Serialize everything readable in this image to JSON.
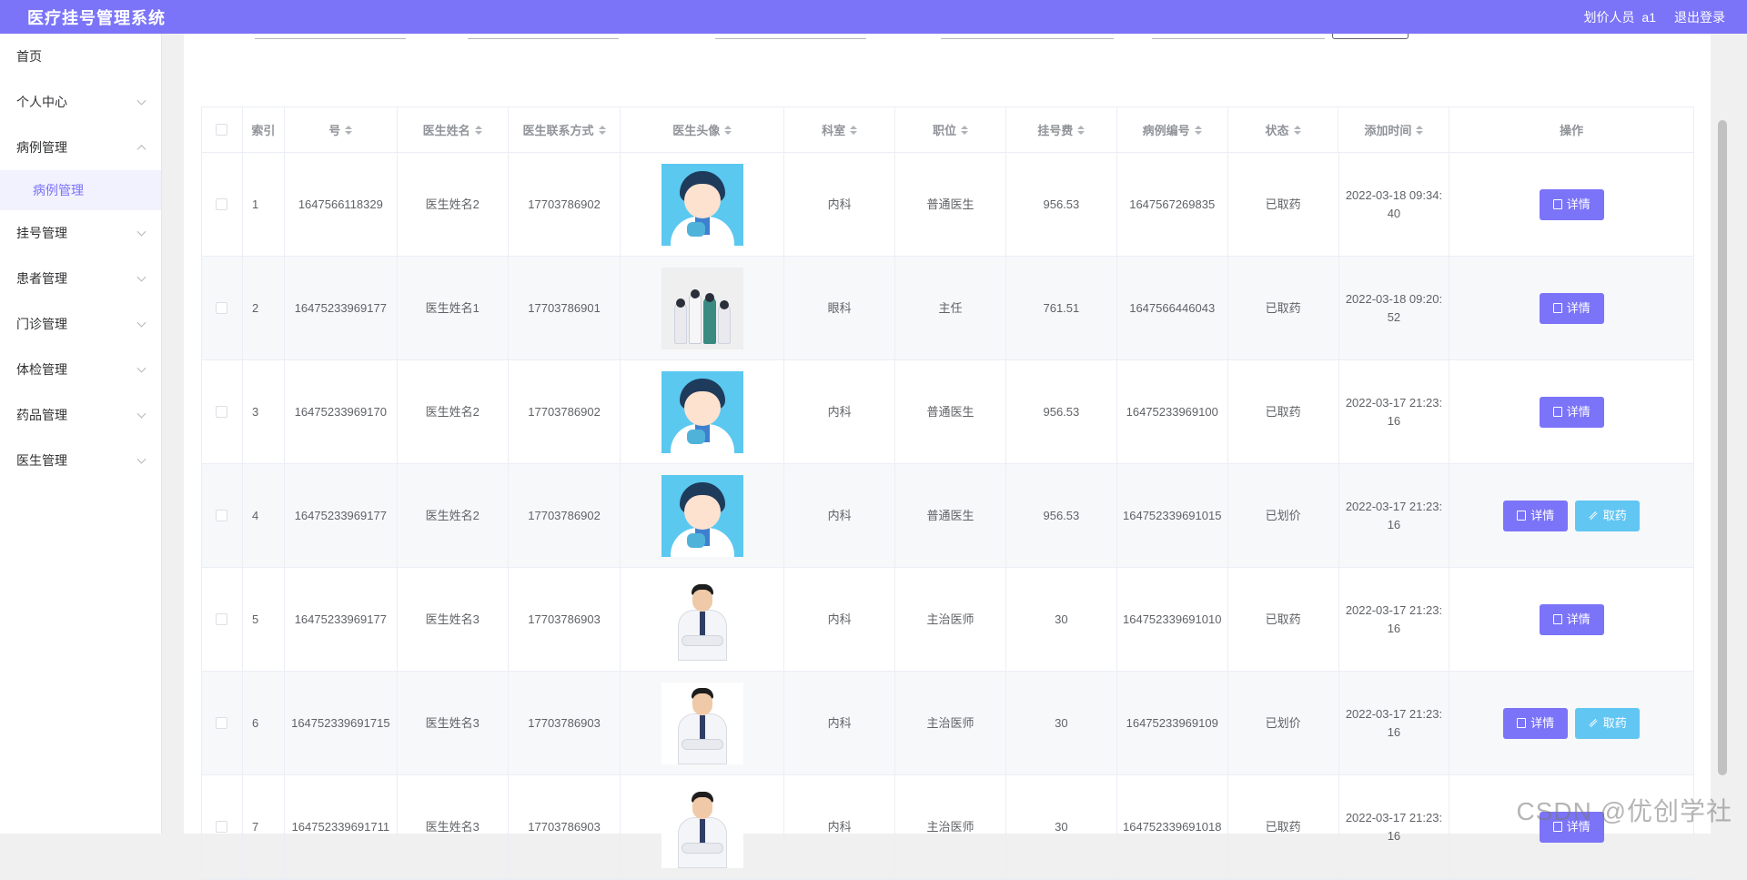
{
  "app": {
    "title": "医疗挂号管理系统"
  },
  "header": {
    "user_role": "划价人员",
    "username": "a1",
    "logout_label": "退出登录"
  },
  "sidebar": {
    "items": [
      {
        "label": "首页"
      },
      {
        "label": "个人中心"
      },
      {
        "label": "病例管理",
        "expanded": true,
        "children": [
          {
            "label": "病例管理",
            "active": true
          }
        ]
      },
      {
        "label": "挂号管理"
      },
      {
        "label": "患者管理"
      },
      {
        "label": "门诊管理"
      },
      {
        "label": "体检管理"
      },
      {
        "label": "药品管理"
      },
      {
        "label": "医生管理"
      }
    ]
  },
  "table": {
    "columns": [
      "索引",
      "号",
      "医生姓名",
      "医生联系方式",
      "医生头像",
      "科室",
      "职位",
      "挂号费",
      "病例编号",
      "状态",
      "添加时间",
      "操作"
    ],
    "detail_label": "详情",
    "take_label": "取药",
    "rows": [
      {
        "index": "1",
        "no": "1647566118329",
        "doctor": "医生姓名2",
        "phone": "17703786902",
        "avatar": "cartoon-doctor",
        "dept": "内科",
        "position": "普通医生",
        "fee": "956.53",
        "case_no": "1647567269835",
        "status": "已取药",
        "time": "2022-03-18 09:34:40",
        "can_take": false
      },
      {
        "index": "2",
        "no": "16475233969177",
        "doctor": "医生姓名1",
        "phone": "17703786901",
        "avatar": "team-illustration",
        "dept": "眼科",
        "position": "主任",
        "fee": "761.51",
        "case_no": "1647566446043",
        "status": "已取药",
        "time": "2022-03-18 09:20:52",
        "can_take": false
      },
      {
        "index": "3",
        "no": "16475233969170",
        "doctor": "医生姓名2",
        "phone": "17703786902",
        "avatar": "cartoon-doctor",
        "dept": "内科",
        "position": "普通医生",
        "fee": "956.53",
        "case_no": "16475233969100",
        "status": "已取药",
        "time": "2022-03-17 21:23:16",
        "can_take": false
      },
      {
        "index": "4",
        "no": "16475233969177",
        "doctor": "医生姓名2",
        "phone": "17703786902",
        "avatar": "cartoon-doctor",
        "dept": "内科",
        "position": "普通医生",
        "fee": "956.53",
        "case_no": "164752339691015",
        "status": "已划价",
        "time": "2022-03-17 21:23:16",
        "can_take": true
      },
      {
        "index": "5",
        "no": "16475233969177",
        "doctor": "医生姓名3",
        "phone": "17703786903",
        "avatar": "photo-doctor",
        "dept": "内科",
        "position": "主治医师",
        "fee": "30",
        "case_no": "164752339691010",
        "status": "已取药",
        "time": "2022-03-17 21:23:16",
        "can_take": false
      },
      {
        "index": "6",
        "no": "164752339691715",
        "doctor": "医生姓名3",
        "phone": "17703786903",
        "avatar": "photo-doctor",
        "dept": "内科",
        "position": "主治医师",
        "fee": "30",
        "case_no": "16475233969109",
        "status": "已划价",
        "time": "2022-03-17 21:23:16",
        "can_take": true
      },
      {
        "index": "7",
        "no": "164752339691711",
        "doctor": "医生姓名3",
        "phone": "17703786903",
        "avatar": "photo-doctor",
        "dept": "内科",
        "position": "主治医师",
        "fee": "30",
        "case_no": "164752339691018",
        "status": "已取药",
        "time": "2022-03-17 21:23:16",
        "can_take": false
      }
    ]
  },
  "watermark": "CSDN @优创学社",
  "colors": {
    "primary": "#7b74f8",
    "info": "#62c6f3"
  }
}
